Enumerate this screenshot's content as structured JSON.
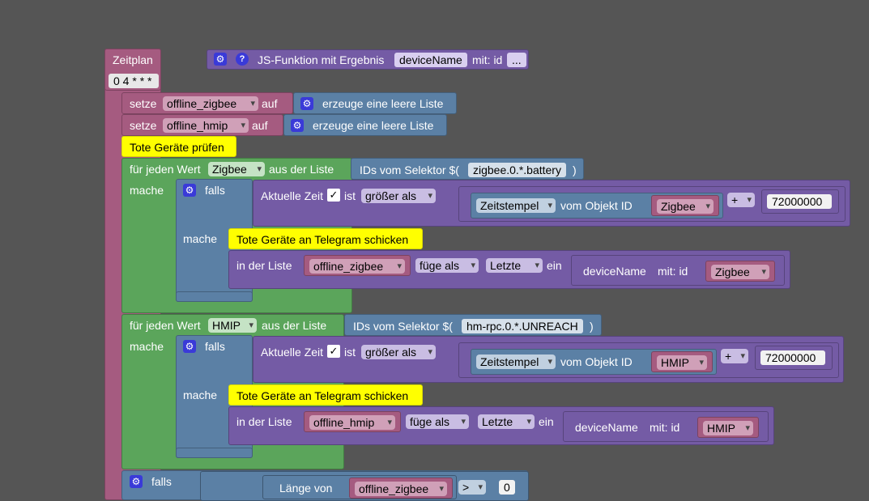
{
  "schedule": {
    "label": "Zeitplan",
    "cron": "0 4 * * *"
  },
  "js_function": {
    "label": "JS-Funktion mit Ergebnis",
    "name": "deviceName",
    "param_label": "mit: id",
    "more": "..."
  },
  "set1": {
    "set_label": "setze",
    "var": "offline_zigbee",
    "to_label": "auf",
    "value": "erzeuge eine leere Liste"
  },
  "set2": {
    "set_label": "setze",
    "var": "offline_hmip",
    "to_label": "auf",
    "value": "erzeuge eine leere Liste"
  },
  "comment1": "Tote Geräte prüfen",
  "loop1": {
    "for_label": "für jeden Wert",
    "var": "Zigbee",
    "from_label": "aus der Liste",
    "selector_label": "IDs vom Selektor $(",
    "selector": "zigbee.0.*.battery",
    "selector_close": ")",
    "do_label": "mache",
    "if_label": "falls",
    "time_label": "Aktuelle Zeit",
    "check": "✓",
    "is_label": "ist",
    "op": "größer als",
    "ts": "Zeitstempel",
    "obj_label": "vom Objekt ID",
    "obj_var": "Zigbee",
    "plus": "+",
    "add_value": "72000000",
    "then_label": "mache",
    "comment": "Tote Geräte an Telegram schicken",
    "list_label": "in der Liste",
    "list_var": "offline_zigbee",
    "insert_label": "füge als",
    "pos": "Letzte",
    "in_label": "ein",
    "fn_name": "deviceName",
    "fn_param": "mit:  id",
    "fn_var": "Zigbee"
  },
  "loop2": {
    "for_label": "für jeden Wert",
    "var": "HMIP",
    "from_label": "aus der Liste",
    "selector_label": "IDs vom Selektor $(",
    "selector": "hm-rpc.0.*.UNREACH",
    "selector_close": ")",
    "do_label": "mache",
    "if_label": "falls",
    "time_label": "Aktuelle Zeit",
    "check": "✓",
    "is_label": "ist",
    "op": "größer als",
    "ts": "Zeitstempel",
    "obj_label": "vom Objekt ID",
    "obj_var": "HMIP",
    "plus": "+",
    "add_value": "72000000",
    "then_label": "mache",
    "comment": "Tote Geräte an Telegram schicken",
    "list_label": "in der Liste",
    "list_var": "offline_hmip",
    "insert_label": "füge als",
    "pos": "Letzte",
    "in_label": "ein",
    "fn_name": "deviceName",
    "fn_param": "mit:  id",
    "fn_var": "HMIP"
  },
  "if_bottom": {
    "if_label": "falls",
    "length_label": "Länge von",
    "var": "offline_zigbee",
    "op": ">",
    "value": "0"
  },
  "icons": {
    "gear": "⚙",
    "help": "?"
  }
}
